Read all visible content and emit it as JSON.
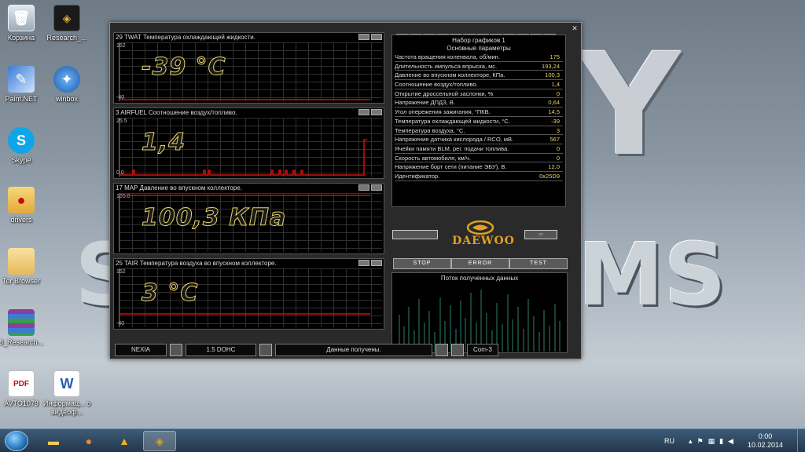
{
  "desktop": {
    "icons": [
      {
        "label": "Корзина"
      },
      {
        "label": "Research_..."
      },
      {
        "label": "Paint.NET"
      },
      {
        "label": "winbox"
      },
      {
        "label": "Skype"
      },
      {
        "label": "drivers"
      },
      {
        "label": "Tor Browser"
      },
      {
        "label": "8_Research..."
      },
      {
        "label": "AVTO1079"
      },
      {
        "label": "Информац... о видеоф..."
      }
    ]
  },
  "panels": [
    {
      "title": "29  TWAT  Температура охлаждающей жидкости.",
      "ymax": "152",
      "ymin": "-40",
      "value": "-39 °C"
    },
    {
      "title": "3  AIRFUEL  Соотношение воздух/топливо.",
      "ymax": "25.5",
      "ymin": "0.0",
      "value": "1,4"
    },
    {
      "title": "17  MAP  Давление во впускном коллекторе.",
      "ymax": "105.0",
      "ymin": "",
      "value": "100,3 КПа"
    },
    {
      "title": "25  TAIR  Температура воздуха во впускном коллекторе.",
      "ymax": "152",
      "ymin": "-40",
      "value": "3 °C"
    }
  ],
  "params": {
    "header1": "Набор графиков 1",
    "header2": "Основные параметры",
    "rows": [
      {
        "label": "Частота вращения коленвала, об/мин.",
        "value": "175"
      },
      {
        "label": "Длительность импульса впрыска, мс.",
        "value": "193,24"
      },
      {
        "label": "Давление во впускном коллекторе, КПа.",
        "value": "100,3"
      },
      {
        "label": "Соотношение воздух/топливо.",
        "value": "1,4"
      },
      {
        "label": "Открытие дроссельной заслонки, %",
        "value": "0"
      },
      {
        "label": "Напряжение ДПДЗ, В.",
        "value": "0,64"
      },
      {
        "label": "Угол опережения зажигания, °ПКВ.",
        "value": "14,5"
      },
      {
        "label": "Температура охлаждающей жидкости, °С.",
        "value": "-39"
      },
      {
        "label": "Температура воздуха, °С.",
        "value": "3"
      },
      {
        "label": "Напряжение датчика кислорода / RCO, мВ.",
        "value": "567"
      },
      {
        "label": "Ячейки памяти BLM, рег. подачи топлива.",
        "value": "0"
      },
      {
        "label": "Скорость автомобиля, км/ч.",
        "value": "0"
      },
      {
        "label": "Напряжение борт сети (питание ЭБУ), В.",
        "value": "12,0"
      },
      {
        "label": "Идентификатор.",
        "value": "0x25D9"
      }
    ]
  },
  "logo": {
    "brand": "DAEWOO"
  },
  "controls": {
    "stop": "STOP",
    "error": "ERROR",
    "test": "TEST"
  },
  "stream": {
    "title": "Поток полученных данных"
  },
  "status": {
    "car": "NEXIA",
    "engine": "1.5 DOHC",
    "message": "Данные получены.",
    "port": "Com-3"
  },
  "taskbar": {
    "lang": "RU",
    "time": "0:00",
    "date": "10.02.2014"
  },
  "colors": {
    "trace": "#d01010",
    "value_outline": "#e6d46a",
    "brand": "#e0a020"
  }
}
